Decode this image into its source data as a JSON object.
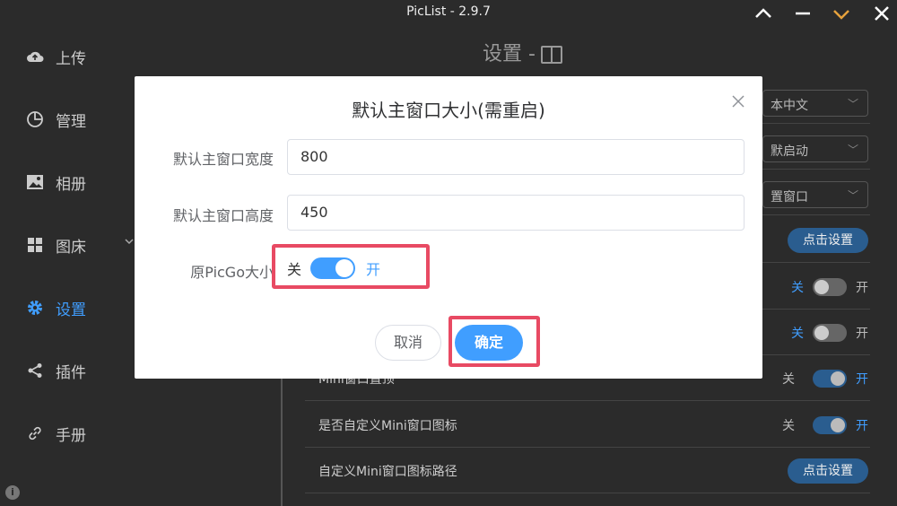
{
  "window": {
    "title": "PicList - 2.9.7",
    "maximize_icon": "chevron-up",
    "restore_icon": "chevron-down",
    "close_icon": "close"
  },
  "sidebar": {
    "items": [
      {
        "label": "上传",
        "icon": "cloud-upload"
      },
      {
        "label": "管理",
        "icon": "pie-chart"
      },
      {
        "label": "相册",
        "icon": "image"
      },
      {
        "label": "图床",
        "icon": "grid"
      },
      {
        "label": "设置",
        "icon": "gear",
        "active": true
      },
      {
        "label": "插件",
        "icon": "share"
      },
      {
        "label": "手册",
        "icon": "link"
      }
    ],
    "info_glyph": "i"
  },
  "settings": {
    "title": "设置 -",
    "rows": [
      {
        "label": "",
        "select": "本中文"
      },
      {
        "label": "",
        "select": "默启动"
      },
      {
        "label": "",
        "select": "置窗口"
      },
      {
        "label": "",
        "button": "点击设置"
      },
      {
        "label": "",
        "switch": {
          "off": "关",
          "on": "开",
          "value": false
        }
      },
      {
        "label": "",
        "switch": {
          "off": "关",
          "on": "开",
          "value": false
        }
      },
      {
        "label": "Mini窗口置顶",
        "switch": {
          "off": "关",
          "on": "开",
          "value": true
        }
      },
      {
        "label": "是否自定义Mini窗口图标",
        "switch": {
          "off": "关",
          "on": "开",
          "value": true
        }
      },
      {
        "label": "自定义Mini窗口图标路径",
        "button": "点击设置"
      }
    ]
  },
  "dialog": {
    "title": "默认主窗口大小(需重启)",
    "width_label": "默认主窗口宽度",
    "width_value": "800",
    "height_label": "默认主窗口高度",
    "height_value": "450",
    "picgo_label": "原PicGo大小",
    "switch_off": "关",
    "switch_on": "开",
    "switch_value": true,
    "cancel": "取消",
    "confirm": "确定",
    "highlight_color": "#e84a63",
    "accent_color": "#409eff"
  }
}
